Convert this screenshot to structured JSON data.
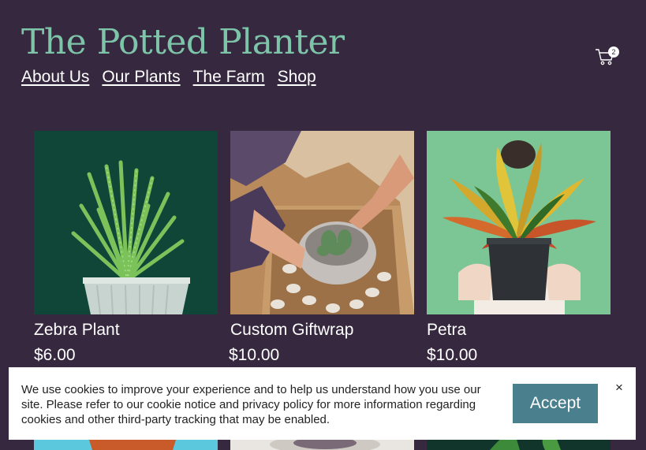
{
  "site": {
    "title": "The Potted Planter"
  },
  "nav": {
    "items": [
      "About Us",
      "Our Plants",
      "The Farm",
      "Shop"
    ]
  },
  "cart": {
    "count": "2",
    "icon": "cart-icon"
  },
  "products": [
    {
      "name": "Zebra Plant",
      "price": "$6.00"
    },
    {
      "name": "Custom Giftwrap",
      "price": "$10.00"
    },
    {
      "name": "Petra",
      "price": "$10.00"
    }
  ],
  "cookie": {
    "text": "We use cookies to improve your experience and to help us understand how you use our site. Please refer to our cookie notice and privacy policy for more information regarding cookies and other third-party tracking that may be enabled.",
    "accept_label": "Accept",
    "close_label": "×"
  },
  "colors": {
    "background": "#35283f",
    "logo": "#7dc4a9",
    "accept": "#4a7f8e"
  }
}
